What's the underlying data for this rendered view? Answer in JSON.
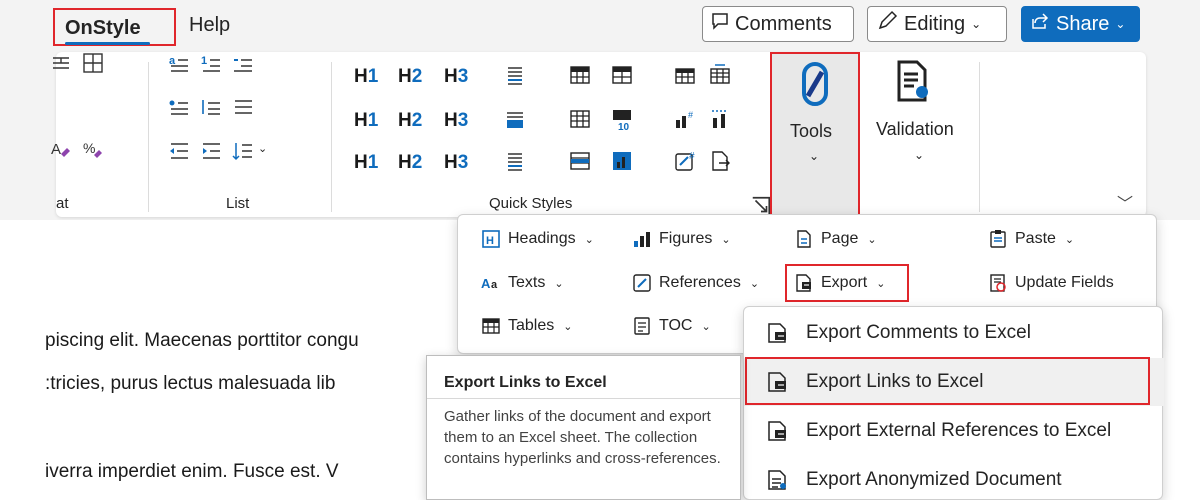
{
  "tabs": {
    "onstyle": "OnStyle",
    "help": "Help"
  },
  "top_buttons": {
    "comments": "Comments",
    "editing": "Editing",
    "share": "Share"
  },
  "ribbon": {
    "group_format_label": "at",
    "group_list_label": "List",
    "group_quick_styles_label": "Quick Styles",
    "headings": {
      "h1": "H",
      "h1_num": "1",
      "h2": "H",
      "h2_num": "2",
      "h3": "H",
      "h3_num": "3"
    },
    "tools_label": "Tools",
    "validation_label": "Validation"
  },
  "tools_menu": {
    "headings": "Headings",
    "figures": "Figures",
    "page": "Page",
    "paste": "Paste",
    "texts": "Texts",
    "references": "References",
    "export": "Export",
    "update_fields": "Update Fields",
    "tables": "Tables",
    "toc": "TOC"
  },
  "export_submenu": [
    {
      "label": "Export Comments to Excel"
    },
    {
      "label": "Export Links to Excel"
    },
    {
      "label": "Export External References to Excel"
    },
    {
      "label": "Export Anonymized Document"
    }
  ],
  "tooltip": {
    "title": "Export Links to Excel",
    "body": "Gather links of the document and export them to an Excel sheet. The collection contains hyperlinks and cross-references."
  },
  "document": {
    "line1": "piscing elit. Maecenas porttitor congu",
    "line2": ":tricies, purus lectus malesuada lib",
    "line3": "iverra imperdiet enim. Fusce est. V"
  },
  "colors": {
    "accent": "#0f6cbd",
    "highlight_border": "#e0262b"
  }
}
